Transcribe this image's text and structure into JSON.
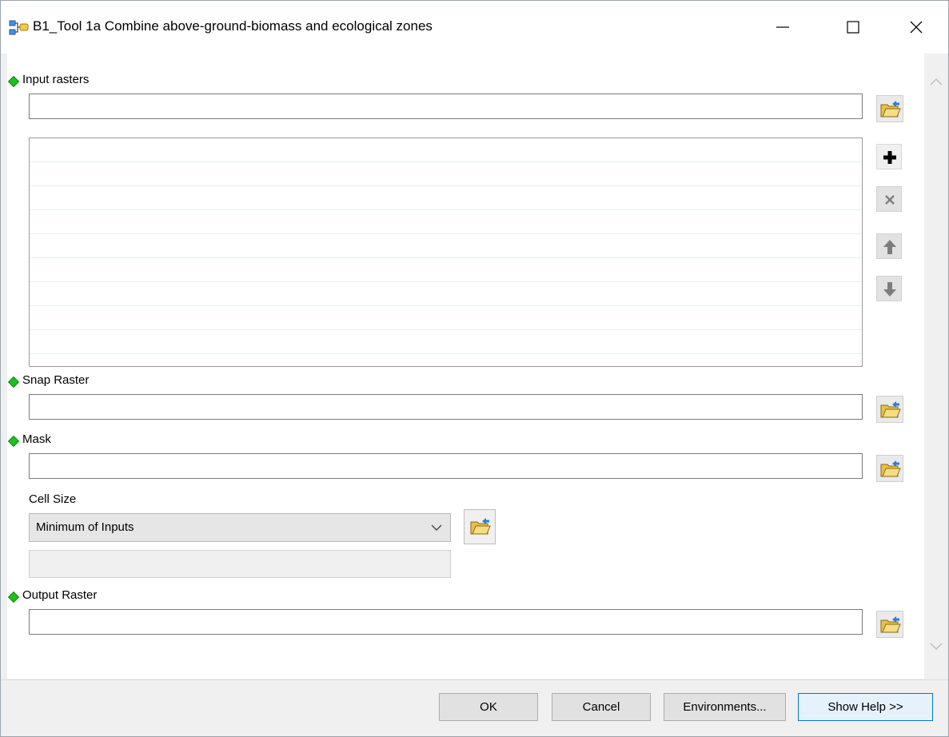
{
  "window": {
    "title": "B1_Tool 1a Combine above-ground-biomass and ecological zones",
    "icon": "model-tool-icon",
    "controls": [
      "minimize-icon",
      "maximize-icon",
      "close-icon"
    ]
  },
  "params": {
    "input_rasters": {
      "label": "Input rasters",
      "value": ""
    },
    "snap_raster": {
      "label": "Snap Raster",
      "value": ""
    },
    "mask": {
      "label": "Mask",
      "value": ""
    },
    "cell_size": {
      "label": "Cell Size",
      "selected": "Minimum of Inputs",
      "value": ""
    },
    "output_raster": {
      "label": "Output Raster",
      "value": ""
    }
  },
  "list_controls": [
    "add-icon",
    "remove-icon",
    "move-up-icon",
    "move-down-icon"
  ],
  "buttons": {
    "ok": "OK",
    "cancel": "Cancel",
    "environments": "Environments...",
    "show_help": "Show Help >>"
  },
  "colors": {
    "required_bullet": "#1fbf1f",
    "folder": "#e8c04a",
    "focus_border": "#0078d7"
  }
}
